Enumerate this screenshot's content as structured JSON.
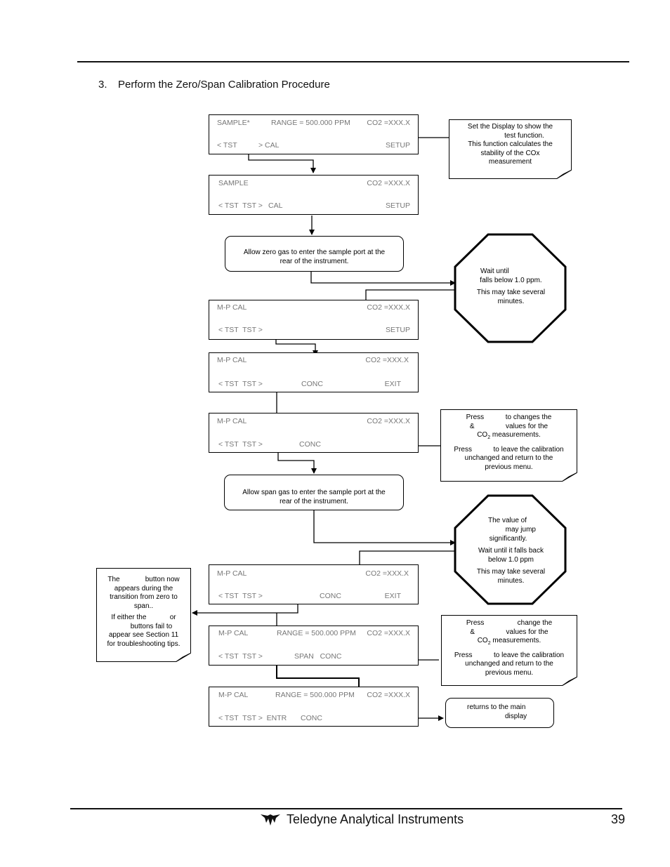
{
  "heading": {
    "number": "3.",
    "text": "Perform the Zero/Span Calibration Procedure"
  },
  "screens": [
    {
      "id": "screen-1",
      "row1": {
        "left": "SAMPLE*",
        "mid": "RANGE = 500.000 PPM",
        "right": "CO2 =XXX.X"
      },
      "row2": {
        "a": "< TST",
        "b": "> CAL",
        "c": "",
        "d": "SETUP"
      }
    },
    {
      "id": "screen-2",
      "row1": {
        "left": "SAMPLE",
        "mid": "",
        "right": "CO2 =XXX.X"
      },
      "row2": {
        "a": "< TST  TST >",
        "b": "CAL",
        "c": "",
        "d": "SETUP"
      }
    },
    {
      "id": "screen-3",
      "row1": {
        "left": "M-P CAL",
        "mid": "",
        "right": "CO2 =XXX.X"
      },
      "row2": {
        "a": "< TST  TST >",
        "b": "",
        "c": "",
        "d": "SETUP"
      }
    },
    {
      "id": "screen-4",
      "row1": {
        "left": "M-P CAL",
        "mid": "",
        "right": "CO2 =XXX.X"
      },
      "row2": {
        "a": "< TST  TST >",
        "b": "CONC",
        "c": "",
        "d": "EXIT"
      }
    },
    {
      "id": "screen-5",
      "row1": {
        "left": "M-P CAL",
        "mid": "",
        "right": "CO2 =XXX.X"
      },
      "row2": {
        "a": "< TST  TST >",
        "b": "CONC",
        "c": "",
        "d": ""
      }
    },
    {
      "id": "screen-6",
      "row1": {
        "left": "M-P CAL",
        "mid": "",
        "right": "CO2 =XXX.X"
      },
      "row2": {
        "a": "< TST  TST >",
        "b": "CONC",
        "c": "",
        "d": "EXIT"
      }
    },
    {
      "id": "screen-7",
      "row1": {
        "left": "M-P CAL",
        "mid": "RANGE = 500.000 PPM",
        "right": "CO2 =XXX.X"
      },
      "row2": {
        "a": "< TST  TST >",
        "b": "SPAN   CONC",
        "c": "",
        "d": ""
      }
    },
    {
      "id": "screen-8",
      "row1": {
        "left": "M-P CAL",
        "mid": "RANGE = 500.000 PPM",
        "right": "CO2 =XXX.X"
      },
      "row2": {
        "a": "< TST  TST >  ENTR",
        "b": "CONC",
        "c": "",
        "d": ""
      }
    }
  ],
  "notes": {
    "set_display": [
      "Set the Display to show the",
      "test function.",
      "This function calculates the",
      "stability of the COx",
      "measurement"
    ],
    "press_zero": {
      "p1": [
        "Press           to changes the",
        "&                values for the",
        "CO2 measurements."
      ],
      "p2": [
        "Press           to leave the calibration",
        "unchanged and return to the",
        "previous menu."
      ]
    },
    "press_span": {
      "p1": [
        "Press                 change the",
        "&                values for the",
        "CO2 measurements."
      ],
      "p2": [
        "Press           to leave the calibration",
        "unchanged and return to the",
        "previous menu."
      ]
    },
    "span_button": {
      "p1": [
        "The             button now",
        "appears during the",
        "transition from zero to",
        "span.."
      ],
      "p2": [
        "If either the            or",
        "buttons fail to",
        "appear see Section 11",
        "for troubleshooting tips."
      ]
    }
  },
  "rounded": {
    "zero_gas": [
      "Allow zero gas to enter the sample port at the",
      "rear of the instrument."
    ],
    "span_gas": [
      "Allow span gas to enter the sample port at the",
      "rear of the instrument."
    ],
    "returns": [
      "returns to the main",
      "display"
    ]
  },
  "stop_signs": {
    "wait_zero": {
      "p1": [
        "Wait until",
        "falls below 1.0  ppm."
      ],
      "p2": [
        "This may take several",
        "minutes."
      ]
    },
    "wait_span": {
      "p1": [
        "The value of",
        "may jump",
        "significantly."
      ],
      "p2": [
        "Wait until it falls back",
        "below  1.0  ppm"
      ],
      "p3": [
        "This may take several",
        "minutes."
      ]
    }
  },
  "footer": {
    "brand": "Teledyne Analytical Instruments",
    "page_number": "39",
    "logo_icon": "teledyne-logo-icon"
  }
}
